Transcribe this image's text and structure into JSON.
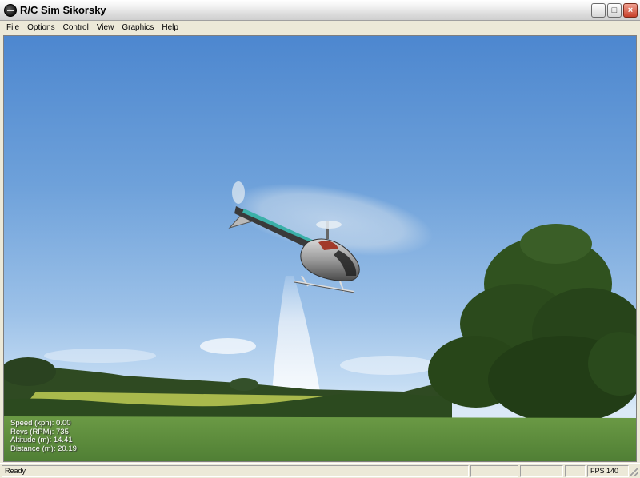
{
  "window": {
    "title": "R/C Sim Sikorsky",
    "app_icon": "app-logo-icon",
    "controls": {
      "minimize": "_",
      "maximize": "□",
      "close": "×"
    }
  },
  "menu": [
    "File",
    "Options",
    "Control",
    "View",
    "Graphics",
    "Help"
  ],
  "scene": {
    "sky_colors": [
      "#4d87cf",
      "#9cc1e8",
      "#dbe9f7"
    ],
    "grass_color": "#5a8a3c",
    "field_color": "#a9b94c"
  },
  "hud": {
    "speed": "Speed (kph): 0.00",
    "revs": "Revs (RPM): 735",
    "altitude": "Altitude (m): 14.41",
    "distance": "Distance (m): 20.19"
  },
  "status": {
    "text": "Ready",
    "fps": "FPS 140"
  }
}
